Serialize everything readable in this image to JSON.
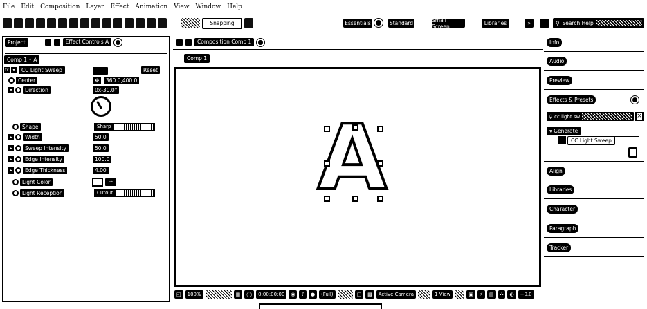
{
  "menu": [
    "File",
    "Edit",
    "Composition",
    "Layer",
    "Effect",
    "Animation",
    "View",
    "Window",
    "Help"
  ],
  "toolbar": {
    "snapping_label": "Snapping",
    "workspaces": [
      "Essentials",
      "Standard",
      "Small Screen",
      "Libraries"
    ],
    "search_help": "Search Help"
  },
  "left_panel": {
    "tab_project": "Project",
    "tab_effect_controls": "Effect Controls A",
    "breadcrumb": "Comp 1 • A",
    "effect_name": "CC Light Sweep",
    "reset_label": "Reset",
    "properties": [
      {
        "label": "Center",
        "value": "360.0,400.0"
      },
      {
        "label": "Direction",
        "value": "0x-30.0°"
      },
      {
        "label": "Shape",
        "value": "Sharp"
      },
      {
        "label": "Width",
        "value": "50.0"
      },
      {
        "label": "Sweep Intensity",
        "value": "50.0"
      },
      {
        "label": "Edge Intensity",
        "value": "100.0"
      },
      {
        "label": "Edge Thickness",
        "value": "4.00"
      },
      {
        "label": "Light Color",
        "value": ""
      },
      {
        "label": "Light Reception",
        "value": "Cutout"
      }
    ]
  },
  "composition": {
    "panel_tab": "Composition Comp 1",
    "comp_tab": "Comp 1",
    "glyph": "A"
  },
  "viewer_bar": {
    "zoom": "100%",
    "timecode": "0:00:00:00",
    "resolution": "(Full)",
    "camera": "Active Camera",
    "view": "1 View",
    "exposure": "+0.0"
  },
  "right_panel": {
    "items_top": [
      "Info",
      "Audio",
      "Preview",
      "Effects & Presets"
    ],
    "search_value": "cc light sw",
    "category": "Generate",
    "effect_result": "CC Light Sweep",
    "items_bottom": [
      "Align",
      "Libraries",
      "Character",
      "Paragraph",
      "Tracker"
    ]
  }
}
